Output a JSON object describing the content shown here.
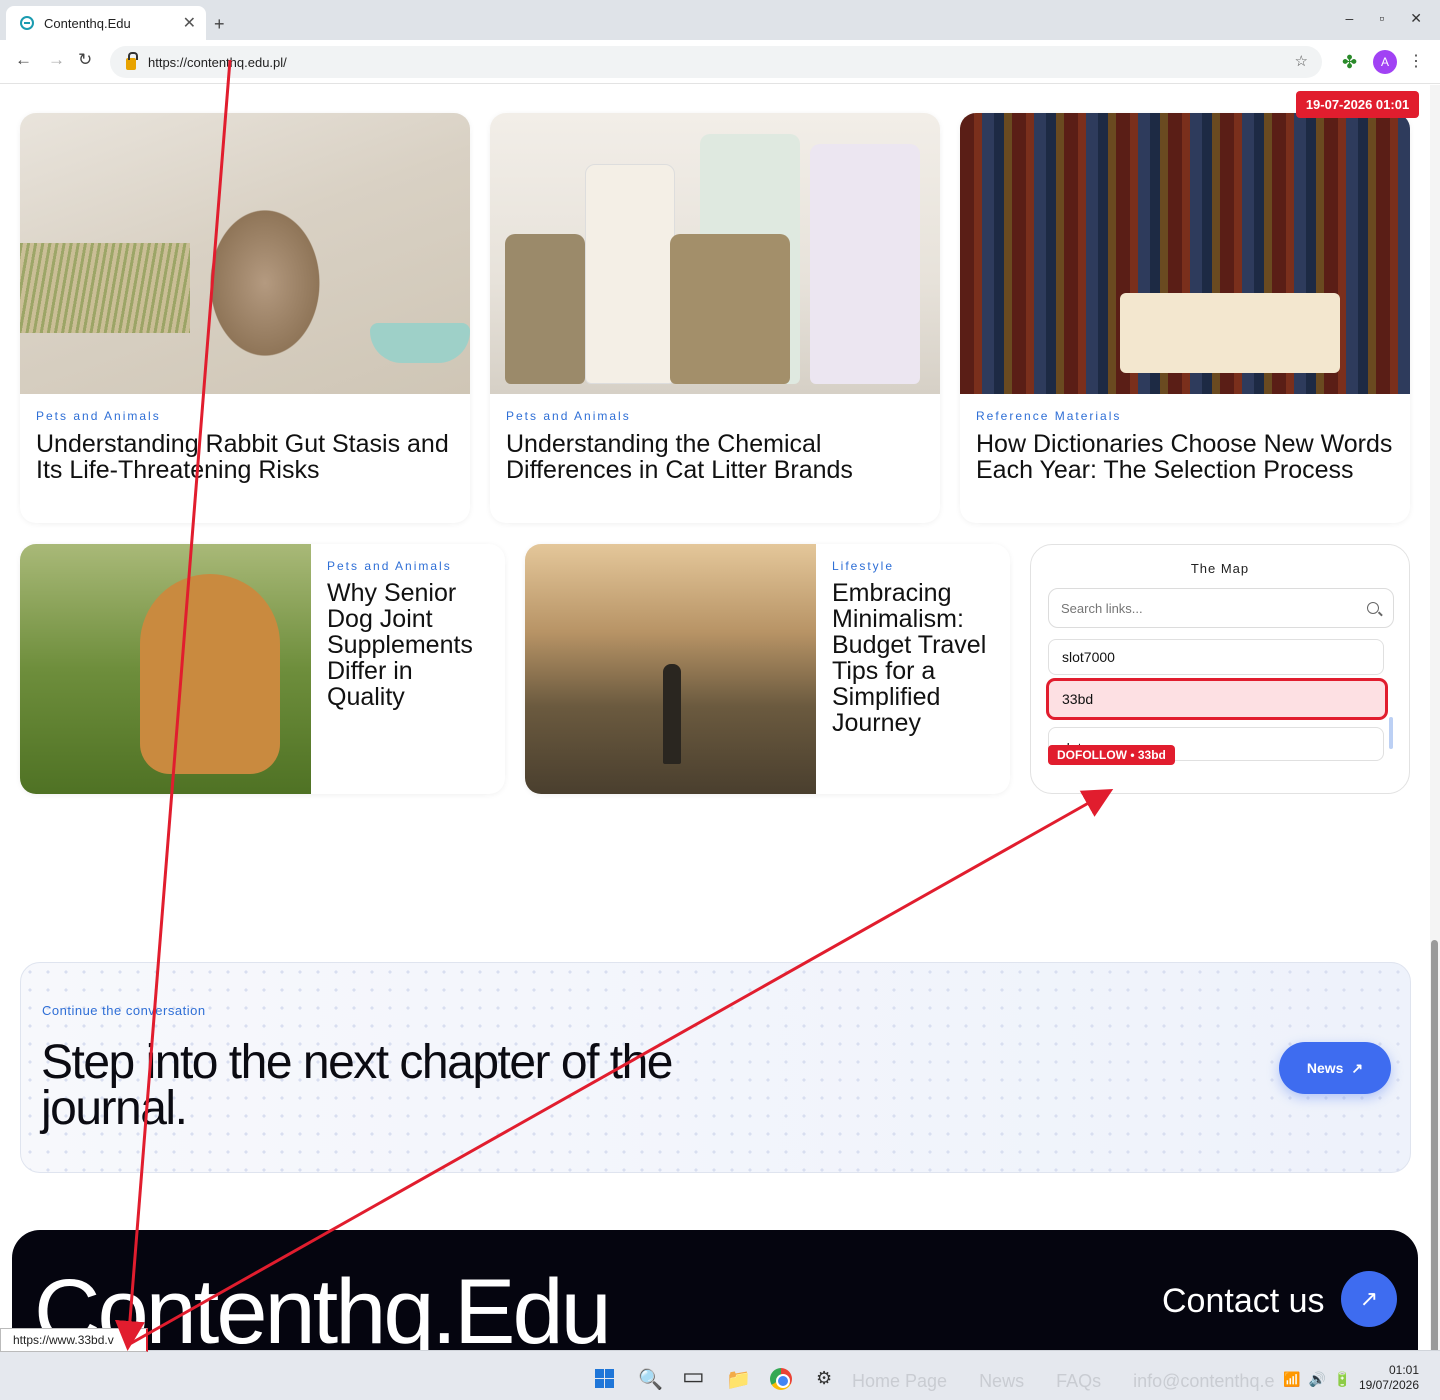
{
  "browser": {
    "tab_title": "Contenthq.Edu",
    "new_tab": "+",
    "close_tab": "✕",
    "url": "https://contenthq.edu.pl/",
    "profile_initial": "A",
    "controls": {
      "minimize": "–",
      "maximize": "▫",
      "close": "✕"
    },
    "nav": {
      "back": "←",
      "forward": "→",
      "reload": "↻"
    },
    "star": "☆",
    "kebab": "⋮",
    "extension": "✤"
  },
  "timestamp_badge": "19-07-2026 01:01",
  "cards": [
    {
      "category": "Pets and Animals",
      "title": "Understanding Rabbit Gut Stasis and Its Life-Threatening Risks"
    },
    {
      "category": "Pets and Animals",
      "title": "Understanding the Chemical Differences in Cat Litter Brands"
    },
    {
      "category": "Reference Materials",
      "title": "How Dictionaries Choose New Words Each Year: The Selection Process"
    },
    {
      "category": "Pets and Animals",
      "title": "Why Senior Dog Joint Supplements Differ in Quality"
    },
    {
      "category": "Lifestyle",
      "title": "Embracing Minimalism: Budget Travel Tips for a Simplified Journey"
    }
  ],
  "map": {
    "title": "The Map",
    "search_placeholder": "Search links...",
    "links": [
      "slot7000",
      "33bd",
      "data macau"
    ],
    "selected_index": 1,
    "badge": "DOFOLLOW • 33bd"
  },
  "cta": {
    "kicker": "Continue the conversation",
    "title": "Step into the next chapter of the journal.",
    "button_label": "News",
    "button_arrow": "↗"
  },
  "footer": {
    "brand": "Contenthq.Edu",
    "contact_label": "Contact us",
    "contact_arrow": "↗"
  },
  "status_bar_url": "https://www.33bd.v",
  "taskbar": {
    "faint_links": [
      "Home Page",
      "News",
      "FAQs",
      "info@contenthq.e"
    ],
    "time": "01:01",
    "date": "19/07/2026",
    "icons": {
      "search": "🔍",
      "task_view": "▭",
      "folder": "📁",
      "settings": "⚙",
      "wifi": "📶",
      "volume": "🔊",
      "battery": "🔋"
    }
  },
  "colors": {
    "accent_blue": "#3e6cf0",
    "category_blue": "#2f6fd6",
    "annotation_red": "#e11d2e",
    "footer_bg": "#05050f"
  }
}
